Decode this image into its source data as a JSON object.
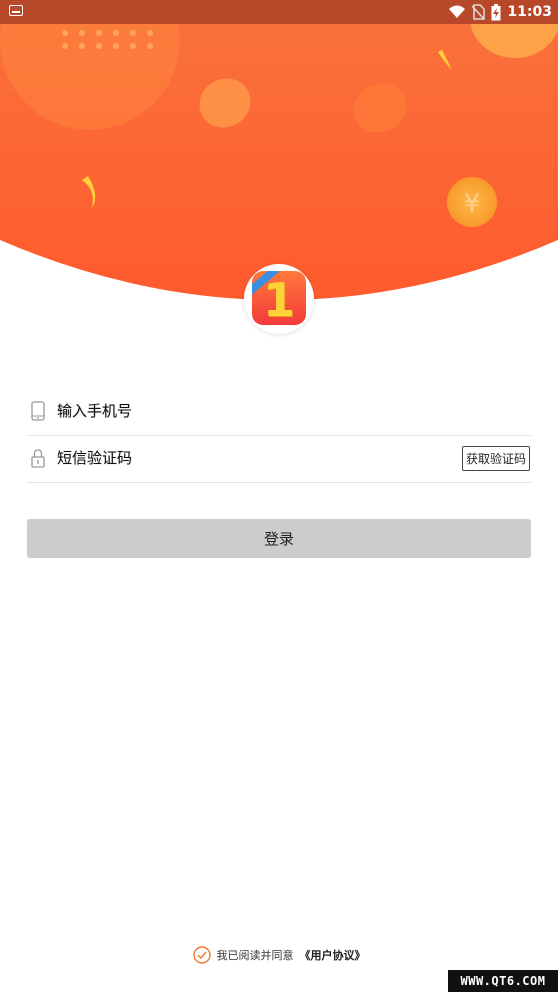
{
  "status_bar": {
    "time": "11:03",
    "icons": [
      "notification-icon",
      "wifi-icon",
      "no-sim-icon",
      "battery-charging-icon"
    ]
  },
  "colors": {
    "accent_orange": "#ff6a35",
    "status_bar": "#b8482a",
    "login_button_bg": "#cccccc",
    "check_color": "#f07a2a"
  },
  "login": {
    "phone_placeholder": "输入手机号",
    "code_placeholder": "短信验证码",
    "get_code_label": "获取验证码",
    "login_label": "登录"
  },
  "agreement": {
    "text": "我已阅读并同意",
    "link": "《用户协议》"
  },
  "watermark": "WWW.QT6.COM"
}
